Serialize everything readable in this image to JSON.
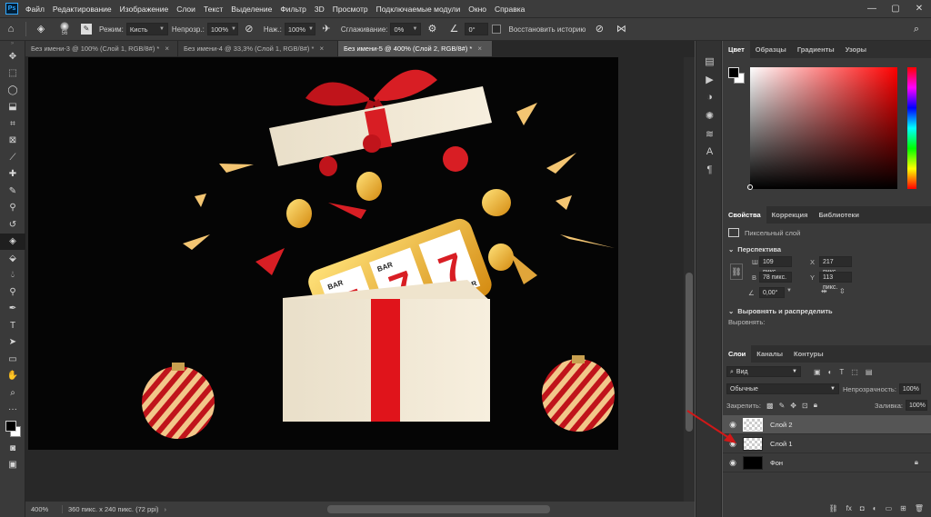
{
  "menubar": {
    "logo": "Ps",
    "items": [
      "Файл",
      "Редактирование",
      "Изображение",
      "Слои",
      "Текст",
      "Выделение",
      "Фильтр",
      "3D",
      "Просмотр",
      "Подключаемые модули",
      "Окно",
      "Справка"
    ],
    "window_controls": [
      "—",
      "▢",
      "✕"
    ]
  },
  "options_bar": {
    "brush_size": "56",
    "mode_label": "Режим:",
    "mode_value": "Кисть",
    "opacity_label": "Непрозр.:",
    "opacity_value": "100%",
    "flow_label": "Наж.:",
    "flow_value": "100%",
    "smoothing_label": "Сглаживание:",
    "smoothing_value": "0%",
    "angle_value": "0°",
    "history_label": "Восстановить историю"
  },
  "tabs": [
    {
      "label": "Без имени-3 @ 100% (Слой 1, RGB/8#) *",
      "close": "×"
    },
    {
      "label": "Без имени-4 @ 33,3% (Слой 1, RGB/8#) *",
      "close": "×"
    },
    {
      "label": "Без имени-5 @ 400% (Слой 2, RGB/8#) *",
      "close": "×"
    }
  ],
  "status": {
    "zoom": "400%",
    "doc_info": "360 пикс. x 240 пикс. (72 ppi)"
  },
  "color_panel": {
    "tabs": [
      "Цвет",
      "Образцы",
      "Градиенты",
      "Узоры"
    ],
    "hue_color": "#ff0000"
  },
  "properties_panel": {
    "tabs": [
      "Свойства",
      "Коррекция",
      "Библиотеки"
    ],
    "layer_type": "Пиксельный слой",
    "transform_title": "Перспектива",
    "w_label": "Ш",
    "w_value": "109 пикс.",
    "x_label": "X",
    "x_value": "217 пикс.",
    "h_label": "В",
    "h_value": "78 пикс.",
    "y_label": "Y",
    "y_value": "113 пикс.",
    "angle_value": "0,00°",
    "align_title": "Выровнять и распределить",
    "align_sub": "Выровнять:"
  },
  "layers_panel": {
    "tabs": [
      "Слои",
      "Каналы",
      "Контуры"
    ],
    "filter_value": "Вид",
    "blend_mode": "Обычные",
    "opacity_label": "Непрозрачность:",
    "opacity_value": "100%",
    "lock_label": "Закрепить:",
    "fill_label": "Заливка:",
    "fill_value": "100%",
    "layers": [
      {
        "name": "Слой 2",
        "selected": true
      },
      {
        "name": "Слой 1",
        "selected": false
      },
      {
        "name": "Фон",
        "selected": false
      }
    ]
  },
  "canvas": {
    "digits": [
      "7",
      "7",
      "7"
    ],
    "reel_bars": [
      "BAR",
      "BAR",
      "BAR"
    ]
  }
}
